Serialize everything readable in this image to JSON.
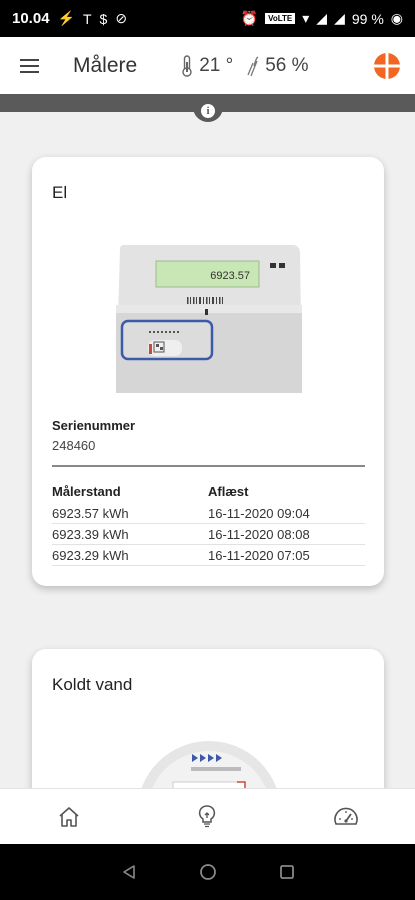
{
  "status_bar": {
    "time": "10.04",
    "network_label": "VoLTE",
    "battery": "99 %"
  },
  "app_bar": {
    "title": "Målere",
    "temperature": "21 °",
    "humidity": "56 %"
  },
  "meters": [
    {
      "title": "El",
      "display_reading": "6923.57",
      "serial_label": "Serienummer",
      "serial_value": "248460",
      "columns": [
        "Målerstand",
        "Aflæst"
      ],
      "readings": [
        {
          "value": "6923.57 kWh",
          "time": "16-11-2020 09:04"
        },
        {
          "value": "6923.39 kWh",
          "time": "16-11-2020 08:08"
        },
        {
          "value": "6923.29 kWh",
          "time": "16-11-2020 07:05"
        }
      ]
    },
    {
      "title": "Koldt vand"
    }
  ],
  "colors": {
    "accent": "#f26522",
    "meter_frame": "#3b5aa8",
    "display": "#c9e6b5"
  },
  "icons": {
    "menu": "hamburger-menu-icon",
    "temperature": "thermometer-icon",
    "humidity": "humidity-icon",
    "info": "info-icon",
    "home": "home-icon",
    "tips": "lightbulb-icon",
    "meters": "speedometer-icon"
  }
}
